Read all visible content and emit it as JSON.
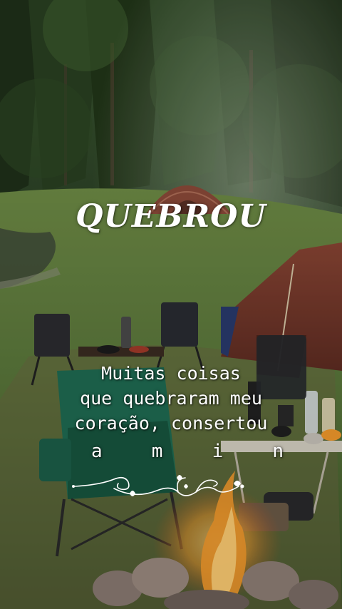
{
  "title": "QUEBROU",
  "caption": {
    "line1": "Muitas coisas",
    "line2": "que quebraram meu",
    "line3": "coração, consertou",
    "letters": [
      "a",
      "m",
      "i",
      "n"
    ]
  },
  "colors": {
    "forest_dark": "#24341d",
    "grass": "#5f7d3a",
    "tent_brown": "#7a3b2c",
    "chair_green": "#1f6b52",
    "fire": "#f39a2c",
    "text": "#ffffff"
  },
  "icons": {
    "ornament": "swirl-ornament-icon"
  }
}
